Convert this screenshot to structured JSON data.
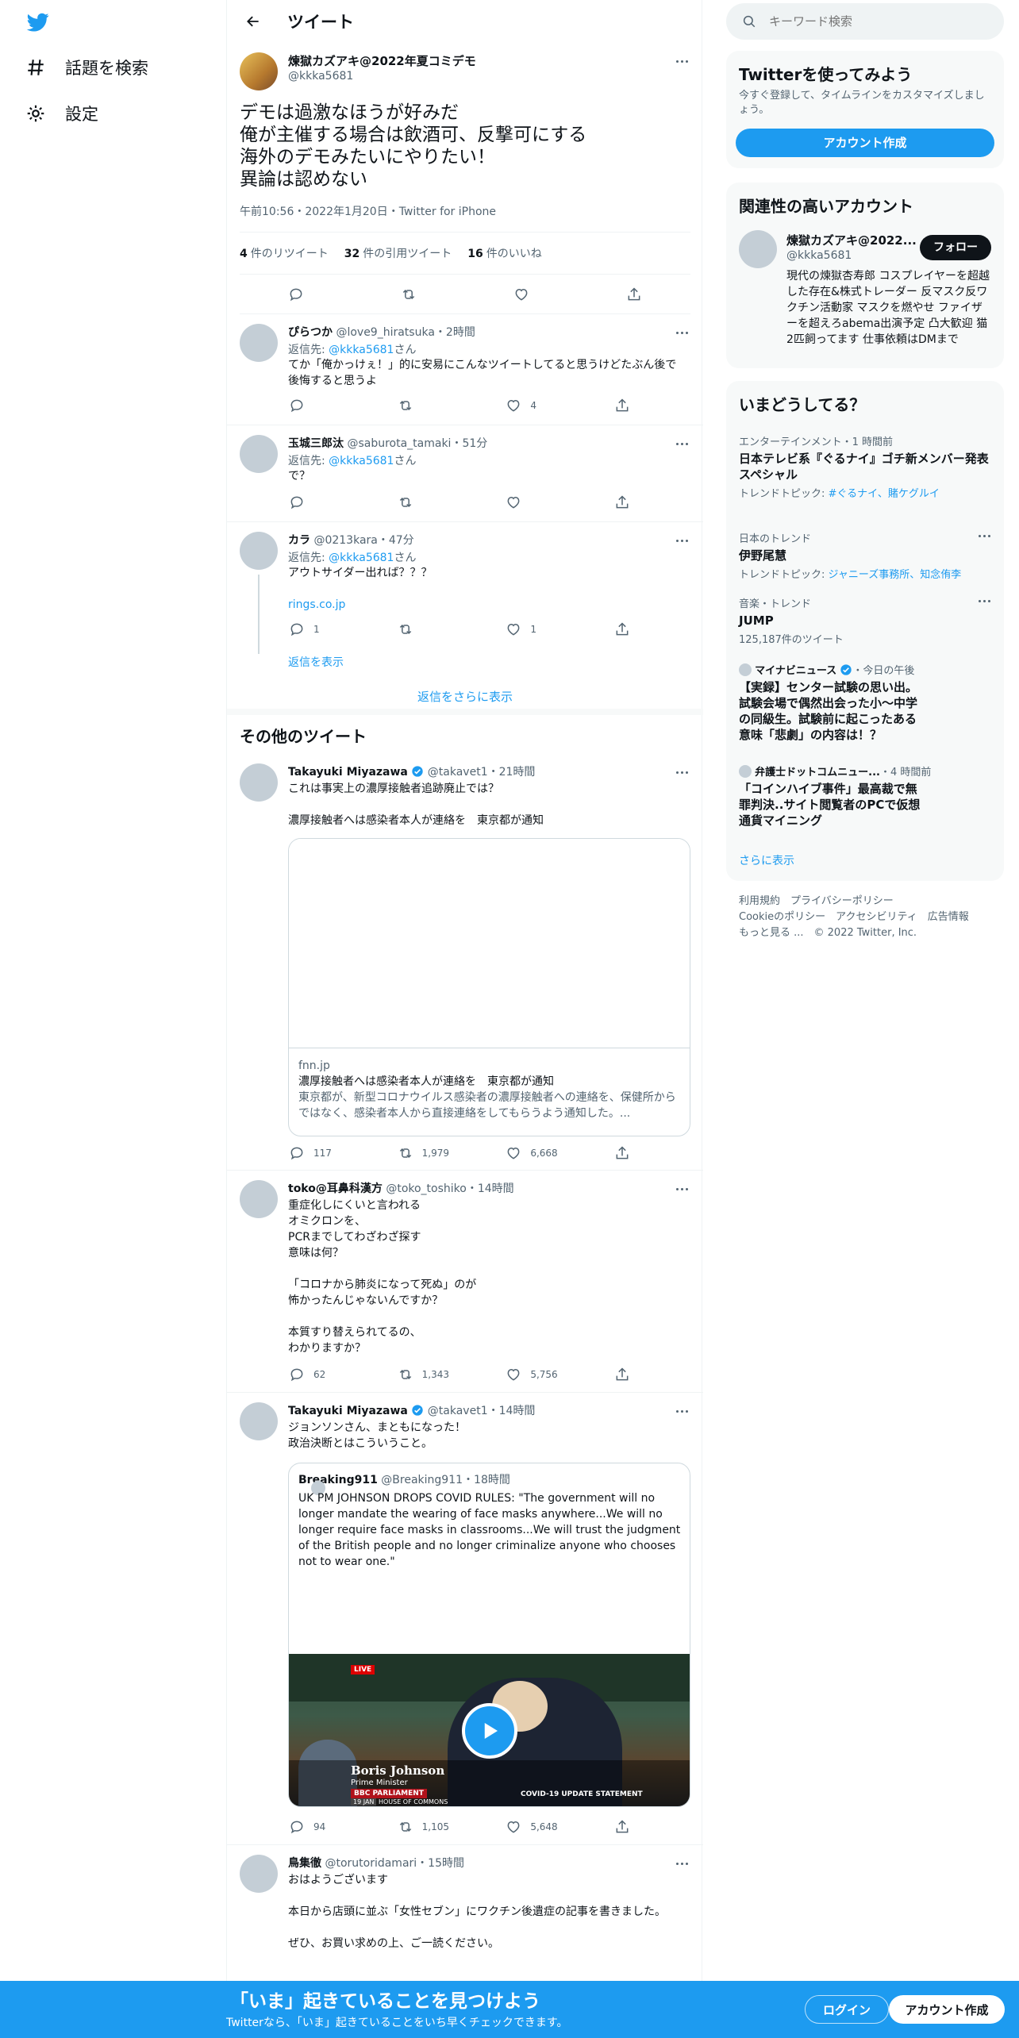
{
  "nav": {
    "explore": "話題を検索",
    "settings": "設定"
  },
  "header": {
    "title": "ツイート"
  },
  "main_tweet": {
    "name": "煉獄カズアキ@2022年夏コミデモ",
    "handle": "@kkka5681",
    "text": "デモは過激なほうが好みだ\n俺が主催する場合は飲酒可、反撃可にする\n海外のデモみたいにやりたい！\n異論は認めない",
    "meta": "午前10:56・2022年1月20日・Twitter for iPhone",
    "retweets_count": "4",
    "retweets_label": "件のリツイート",
    "quotes_count": "32",
    "quotes_label": "件の引用ツイート",
    "likes_count": "16",
    "likes_label": "件のいいね"
  },
  "replies": [
    {
      "name": "ぴらつか",
      "handle": "@love9_hiratsuka",
      "time": "・2時間",
      "reply_prefix": "返信先:",
      "reply_to": "@kkka5681",
      "reply_suffix": "さん",
      "text": "てか「俺かっけぇ！」的に安易にこんなツイートしてると思うけどたぶん後で後悔すると思うよ",
      "reply_count": "",
      "rt_count": "",
      "like_count": "4"
    },
    {
      "name": "玉城三郎汰",
      "handle": "@saburota_tamaki",
      "time": "・51分",
      "reply_prefix": "返信先:",
      "reply_to": "@kkka5681",
      "reply_suffix": "さん",
      "text": "で？",
      "reply_count": "",
      "rt_count": "",
      "like_count": ""
    },
    {
      "name": "カラ",
      "handle": "@0213kara",
      "time": "・47分",
      "reply_prefix": "返信先:",
      "reply_to": "@kkka5681",
      "reply_suffix": "さん",
      "text": "アウトサイダー出れば？？？",
      "link": "rings.co.jp",
      "reply_count": "1",
      "rt_count": "",
      "like_count": "1",
      "show_replies": "返信を表示"
    }
  ],
  "show_more_replies": "返信をさらに表示",
  "other_tweets_title": "その他のツイート",
  "other_tweets": [
    {
      "name": "Takayuki Miyazawa",
      "handle": "@takavet1",
      "time": "・21時間",
      "text": "これは事実上の濃厚接触者追跡廃止では？\n\n濃厚接触者へは感染者本人が連絡を　東京都が通知",
      "card_domain": "fnn.jp",
      "card_title": "濃厚接触者へは感染者本人が連絡を　東京都が通知",
      "card_desc": "東京都が、新型コロナウイルス感染者の濃厚接触者への連絡を、保健所からではなく、感染者本人から直接連絡をしてもらうよう通知した。...",
      "reply_count": "117",
      "rt_count": "1,979",
      "like_count": "6,668"
    },
    {
      "name": "toko@耳鼻科漢方",
      "handle": "@toko_toshiko",
      "time": "・14時間",
      "text": "重症化しにくいと言われる\nオミクロンを、\nPCRまでしてわざわざ探す\n意味は何？\n\n「コロナから肺炎になって死ぬ」のが\n怖かったんじゃないんですか？\n\n本質すり替えられてるの、\nわかりますか？",
      "reply_count": "62",
      "rt_count": "1,343",
      "like_count": "5,756"
    },
    {
      "name": "Takayuki Miyazawa",
      "handle": "@takavet1",
      "time": "・14時間",
      "text": "ジョンソンさん、まともになった！\n政治決断とはこういうこと。",
      "quote_name": "Breaking911",
      "quote_handle": "@Breaking911",
      "quote_time": "・18時間",
      "quote_text": "UK PM JOHNSON DROPS COVID RULES: \"The government will no longer mandate the wearing of face masks anywhere...We will no longer require face masks in classrooms...We will trust the judgment of the British people and no longer criminalize anyone who chooses not to wear one.\"",
      "video_live": "LIVE",
      "video_person": "Boris Johnson",
      "video_role": "Prime Minister",
      "video_channel": "BBC PARLIAMENT",
      "video_date": "19 JAN",
      "video_house": "HOUSE OF COMMONS",
      "video_caption": "COVID-19 UPDATE STATEMENT",
      "reply_count": "94",
      "rt_count": "1,105",
      "like_count": "5,648"
    },
    {
      "name": "鳥集徹",
      "handle": "@torutoridamari",
      "time": "・15時間",
      "text": "おはようございます\n\n本日から店頭に並ぶ「女性セブン」にワクチン後遺症の記事を書きました。\n\nぜひ、お買い求めの上、ご一読ください。"
    }
  ],
  "search": {
    "placeholder": "キーワード検索"
  },
  "signup_panel": {
    "title": "Twitterを使ってみよう",
    "desc": "今すぐ登録して、タイムラインをカスタマイズしましょう。",
    "button": "アカウント作成"
  },
  "related": {
    "title": "関連性の高いアカウント",
    "name": "煉獄カズアキ@2022...",
    "handle": "@kkka5681",
    "follow": "フォロー",
    "bio": "現代の煉獄杏寿郎 コスプレイヤーを超越した存在&株式トレーダー 反マスク反ワクチン活動家 マスクを燃やせ ファイザーを超えろabema出演予定 凸大歓迎 猫2匹飼ってます 仕事依頼はDMまで"
  },
  "trends": {
    "title": "いまどうしてる？",
    "items": [
      {
        "ctx": "エンターテインメント・1 時間前",
        "title": "日本テレビ系『ぐるナイ』ゴチ新メンバー発表スペシャル",
        "sub_prefix": "トレンドトピック: ",
        "sub_links": "#ぐるナイ、賭ケグルイ"
      },
      {
        "ctx": "日本のトレンド",
        "title": "伊野尾慧",
        "sub_prefix": "トレンドトピック: ",
        "sub_links": "ジャニーズ事務所、知念侑李"
      },
      {
        "ctx": "音楽・トレンド",
        "title": "JUMP",
        "sub_prefix": "125,187件のツイート",
        "sub_links": ""
      },
      {
        "ctx_name": "マイナビニュース",
        "ctx_time": "・今日の午後",
        "title": "【実録】センター試験の思い出。試験会場で偶然出会った小～中学の同級生。試験前に起こったある意味「悲劇」の内容は！？"
      },
      {
        "ctx_name": "弁護士ドットコムニュー...",
        "ctx_time": "・4 時間前",
        "title": "「コインハイブ事件」最高裁で無罪判決..サイト閲覧者のPCで仮想通貨マイニング"
      }
    ],
    "show_more": "さらに表示"
  },
  "footer": {
    "line1": "利用規約　プライバシーポリシー",
    "line2": "Cookieのポリシー　アクセシビリティ　広告情報",
    "line3": "もっと見る ...　© 2022 Twitter, Inc."
  },
  "bottom_bar": {
    "headline": "「いま」起きていることを見つけよう",
    "sub": "Twitterなら、「いま」起きていることをいち早くチェックできます。",
    "login": "ログイン",
    "signup": "アカウント作成"
  }
}
